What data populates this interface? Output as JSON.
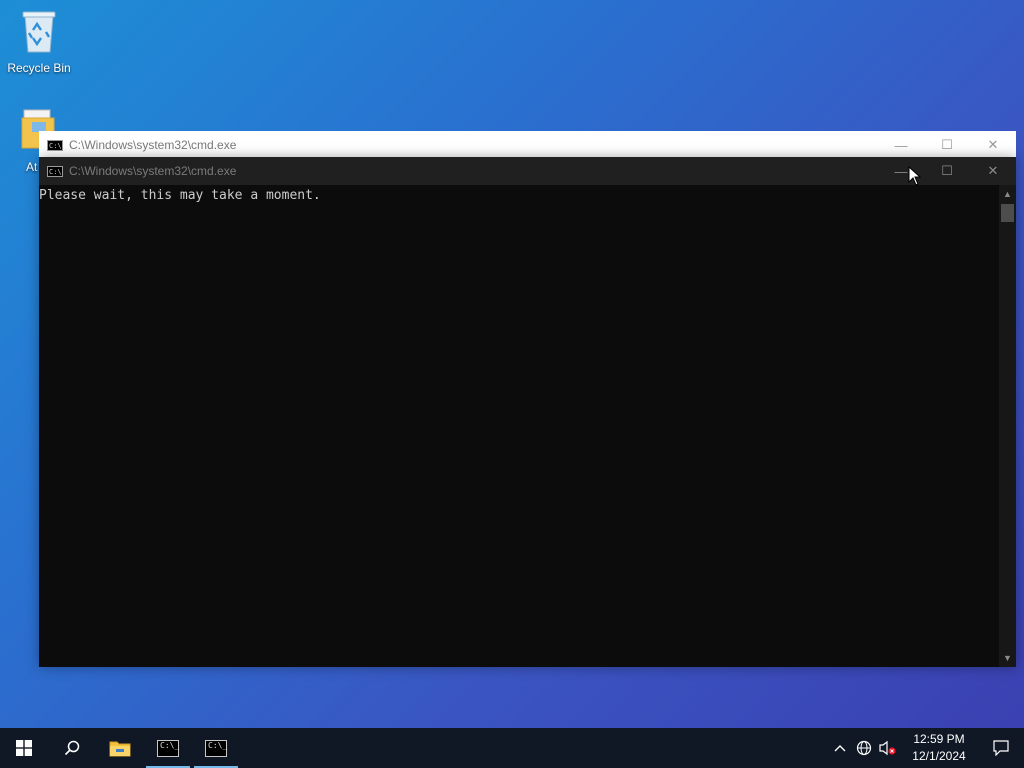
{
  "desktop": {
    "icons": [
      {
        "label": "Recycle Bin",
        "icon": "recycle-bin-icon"
      },
      {
        "label": "At",
        "icon": "folder-icon"
      }
    ]
  },
  "windows": {
    "back": {
      "title": "C:\\Windows\\system32\\cmd.exe",
      "icon_text": "C:\\"
    },
    "front": {
      "title": "C:\\Windows\\system32\\cmd.exe",
      "icon_text": "C:\\",
      "console_text": "Please wait, this may take a moment."
    },
    "controls": {
      "minimize": "—",
      "maximize": "☐",
      "close": "✕"
    }
  },
  "taskbar": {
    "cmd_icon_text": "C:\\_",
    "clock": {
      "time": "12:59 PM",
      "date": "12/1/2024"
    },
    "tray_chevron": "^",
    "accent": "#76b9ed"
  },
  "colors": {
    "console_bg": "#0c0c0c",
    "console_fg": "#cccccc",
    "taskbar_bg": "#101725"
  }
}
